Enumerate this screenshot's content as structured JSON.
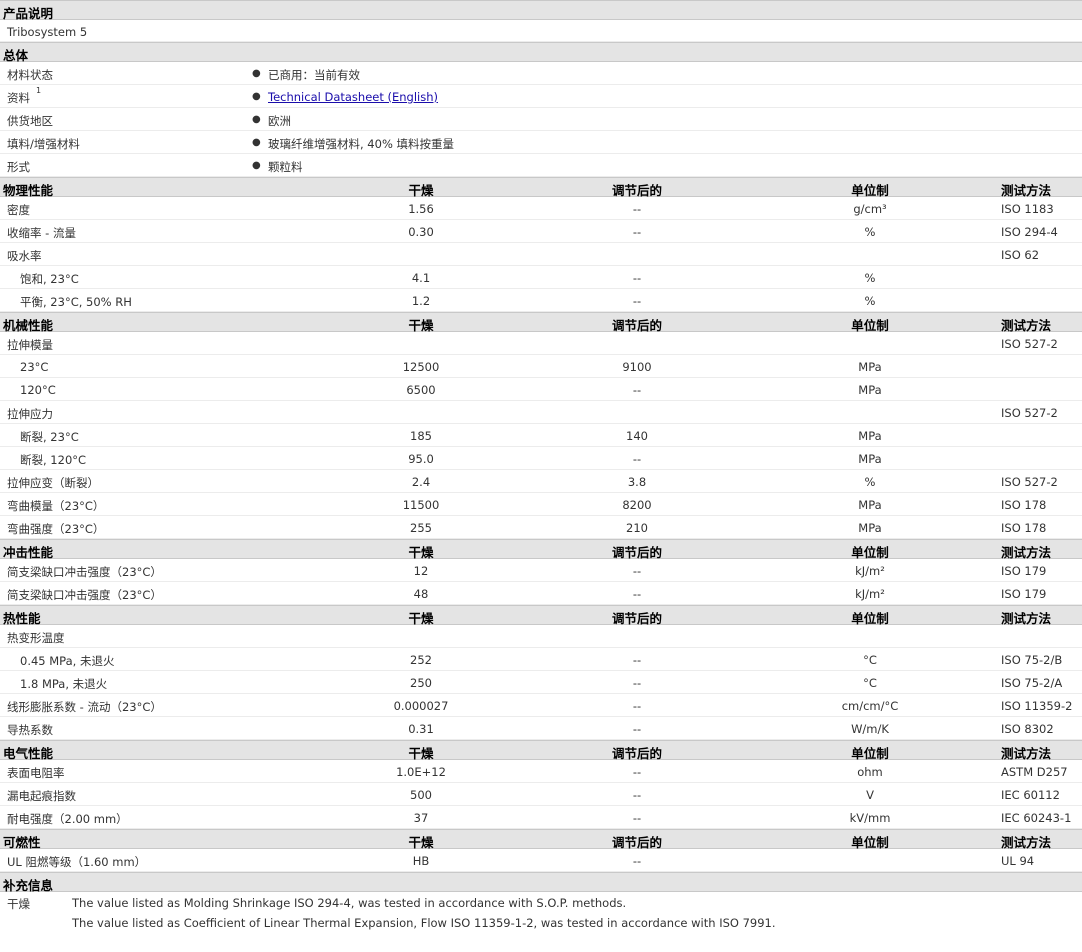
{
  "product": {
    "header": "产品说明",
    "name": "Tribosystem 5"
  },
  "general": {
    "header": "总体",
    "rows": [
      {
        "label": "材料状态",
        "value": "已商用：当前有效"
      },
      {
        "label": "资料",
        "sup": "1",
        "value": "Technical Datasheet (English)"
      },
      {
        "label": "供货地区",
        "value": "欧洲"
      },
      {
        "label": "填料/增强材料",
        "value": "玻璃纤维增强材料, 40% 填料按重量"
      },
      {
        "label": "形式",
        "value": "颗粒料"
      }
    ]
  },
  "columns": {
    "dry": "干燥",
    "conditioned": "调节后的",
    "unit": "单位制",
    "method": "测试方法"
  },
  "physical": {
    "header": "物理性能",
    "rows": [
      {
        "label": "密度",
        "dry": "1.56",
        "cond": "--",
        "unit": "g/cm³",
        "method": "ISO 1183"
      },
      {
        "label": "收缩率 - 流量",
        "dry": "0.30",
        "cond": "--",
        "unit": "%",
        "method": "ISO 294-4"
      },
      {
        "label": "吸水率",
        "dry": "",
        "cond": "",
        "unit": "",
        "method": "ISO 62"
      },
      {
        "label": "饱和, 23°C",
        "sub": true,
        "dry": "4.1",
        "cond": "--",
        "unit": "%",
        "method": ""
      },
      {
        "label": "平衡, 23°C, 50% RH",
        "sub": true,
        "dry": "1.2",
        "cond": "--",
        "unit": "%",
        "method": ""
      }
    ]
  },
  "mechanical": {
    "header": "机械性能",
    "rows": [
      {
        "label": "拉伸模量",
        "dry": "",
        "cond": "",
        "unit": "",
        "method": "ISO 527-2"
      },
      {
        "label": "23°C",
        "sub": true,
        "dry": "12500",
        "cond": "9100",
        "unit": "MPa",
        "method": ""
      },
      {
        "label": "120°C",
        "sub": true,
        "dry": "6500",
        "cond": "--",
        "unit": "MPa",
        "method": ""
      },
      {
        "label": "拉伸应力",
        "dry": "",
        "cond": "",
        "unit": "",
        "method": "ISO 527-2"
      },
      {
        "label": "断裂, 23°C",
        "sub": true,
        "dry": "185",
        "cond": "140",
        "unit": "MPa",
        "method": ""
      },
      {
        "label": "断裂, 120°C",
        "sub": true,
        "dry": "95.0",
        "cond": "--",
        "unit": "MPa",
        "method": ""
      },
      {
        "label": "拉伸应变（断裂）",
        "dry": "2.4",
        "cond": "3.8",
        "unit": "%",
        "method": "ISO 527-2"
      },
      {
        "label": "弯曲模量（23°C）",
        "dry": "11500",
        "cond": "8200",
        "unit": "MPa",
        "method": "ISO 178"
      },
      {
        "label": "弯曲强度（23°C）",
        "dry": "255",
        "cond": "210",
        "unit": "MPa",
        "method": "ISO 178"
      }
    ]
  },
  "impact": {
    "header": "冲击性能",
    "rows": [
      {
        "label": "简支梁缺口冲击强度（23°C）",
        "dry": "12",
        "cond": "--",
        "unit": "kJ/m²",
        "method": "ISO 179"
      },
      {
        "label": "简支梁缺口冲击强度（23°C）",
        "dry": "48",
        "cond": "--",
        "unit": "kJ/m²",
        "method": "ISO 179"
      }
    ]
  },
  "thermal": {
    "header": "热性能",
    "rows": [
      {
        "label": "热变形温度",
        "dry": "",
        "cond": "",
        "unit": "",
        "method": ""
      },
      {
        "label": "0.45 MPa, 未退火",
        "sub": true,
        "dry": "252",
        "cond": "--",
        "unit": "°C",
        "method": "ISO 75-2/B"
      },
      {
        "label": "1.8 MPa, 未退火",
        "sub": true,
        "dry": "250",
        "cond": "--",
        "unit": "°C",
        "method": "ISO 75-2/A"
      },
      {
        "label": "线形膨胀系数 - 流动（23°C）",
        "dry": "0.000027",
        "cond": "--",
        "unit": "cm/cm/°C",
        "method": "ISO 11359-2"
      },
      {
        "label": "导热系数",
        "dry": "0.31",
        "cond": "--",
        "unit": "W/m/K",
        "method": "ISO 8302"
      }
    ]
  },
  "electrical": {
    "header": "电气性能",
    "rows": [
      {
        "label": "表面电阻率",
        "dry": "1.0E+12",
        "cond": "--",
        "unit": "ohm",
        "method": "ASTM D257"
      },
      {
        "label": "漏电起痕指数",
        "dry": "500",
        "cond": "--",
        "unit": "V",
        "method": "IEC 60112"
      },
      {
        "label": "耐电强度（2.00 mm）",
        "dry": "37",
        "cond": "--",
        "unit": "kV/mm",
        "method": "IEC 60243-1"
      }
    ]
  },
  "flammability": {
    "header": "可燃性",
    "rows": [
      {
        "label": "UL 阻燃等级（1.60 mm）",
        "dry": "HB",
        "cond": "--",
        "unit": "",
        "method": "UL 94"
      }
    ]
  },
  "supplemental": {
    "header": "补充信息",
    "label": "干燥",
    "notes": [
      "The value listed as Molding Shrinkage ISO 294-4, was tested in accordance with S.O.P. methods.",
      "The value listed as Coefficient of Linear Thermal Expansion, Flow ISO 11359-1-2, was tested in accordance with ISO 7991."
    ]
  }
}
